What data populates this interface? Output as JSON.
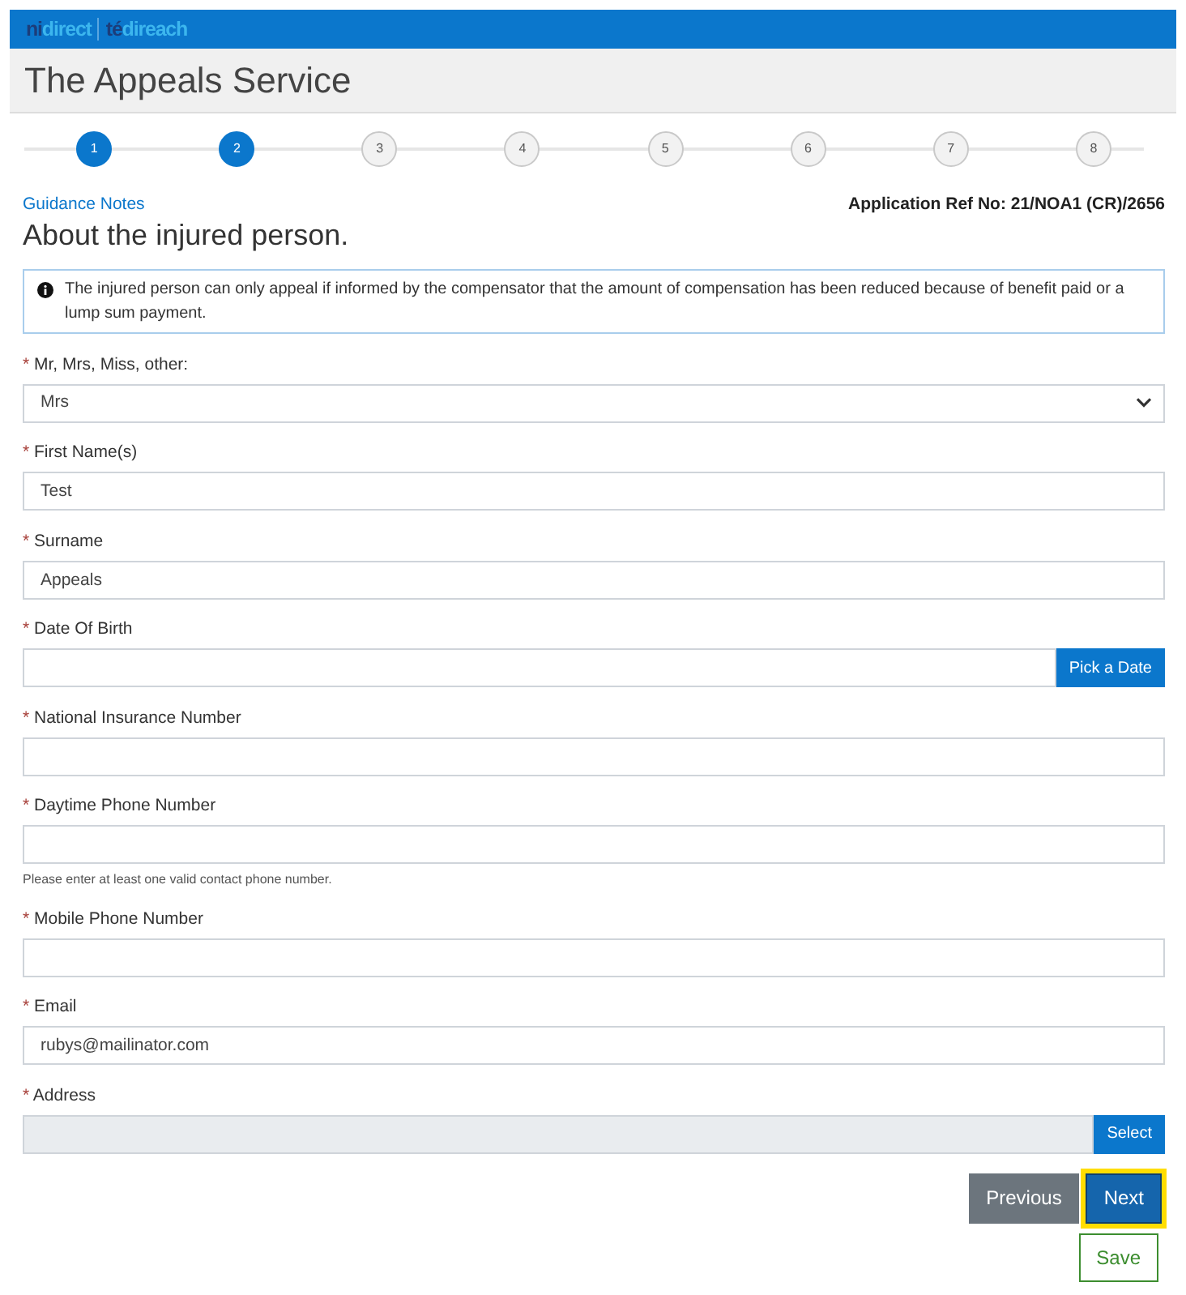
{
  "header": {
    "logo": [
      {
        "parts": [
          {
            "text": "ni",
            "color": "#1c3d7a"
          },
          {
            "text": "direct",
            "color": "#3cb6ee"
          }
        ]
      },
      {
        "parts": [
          {
            "text": "té",
            "color": "#1c3d7a"
          },
          {
            "text": "direach",
            "color": "#3cb6ee"
          }
        ]
      }
    ]
  },
  "page_title": "The Appeals Service",
  "steps": [
    {
      "label": "1",
      "active": true
    },
    {
      "label": "2",
      "active": true
    },
    {
      "label": "3",
      "active": false
    },
    {
      "label": "4",
      "active": false
    },
    {
      "label": "5",
      "active": false
    },
    {
      "label": "6",
      "active": false
    },
    {
      "label": "7",
      "active": false
    },
    {
      "label": "8",
      "active": false
    }
  ],
  "guidance_link": "Guidance Notes",
  "reference": "Application Ref No: 21/NOA1 (CR)/2656",
  "heading": "About the injured person.",
  "notice": "The injured person can only appeal if informed by the compensator that the amount of compensation has been reduced because of benefit paid or a lump sum payment.",
  "fields": [
    {
      "kind": "select",
      "required_mark": "*",
      "label": "Mr, Mrs, Miss, other:",
      "value": "Mrs"
    },
    {
      "kind": "text",
      "required_mark": "*",
      "label": "First Name(s)",
      "value": "Test"
    },
    {
      "kind": "text",
      "required_mark": "*",
      "label": "Surname",
      "value": "Appeals"
    },
    {
      "kind": "picker",
      "required_mark": "*",
      "label": "Date Of Birth",
      "button": "Pick a Date",
      "disabled": false
    },
    {
      "kind": "text",
      "required_mark": "*",
      "label": "National Insurance Number"
    },
    {
      "kind": "text",
      "required_mark": "*",
      "label": "Daytime Phone Number",
      "help": "Please enter at least one valid contact phone number."
    },
    {
      "kind": "text",
      "required_mark": "*",
      "label": "Mobile Phone Number"
    },
    {
      "kind": "text",
      "required_mark": "*",
      "label": "Email",
      "value": "rubys@mailinator.com"
    },
    {
      "kind": "picker",
      "required_mark": "*",
      "label": "Address",
      "button": "Select",
      "disabled": true
    }
  ],
  "nav_buttons": [
    {
      "label": "Previous",
      "kind": "secondary",
      "focused": false
    },
    {
      "label": "Next",
      "kind": "primary",
      "focused": true
    }
  ],
  "save_button": {
    "label": "Save",
    "kind": "outline"
  }
}
